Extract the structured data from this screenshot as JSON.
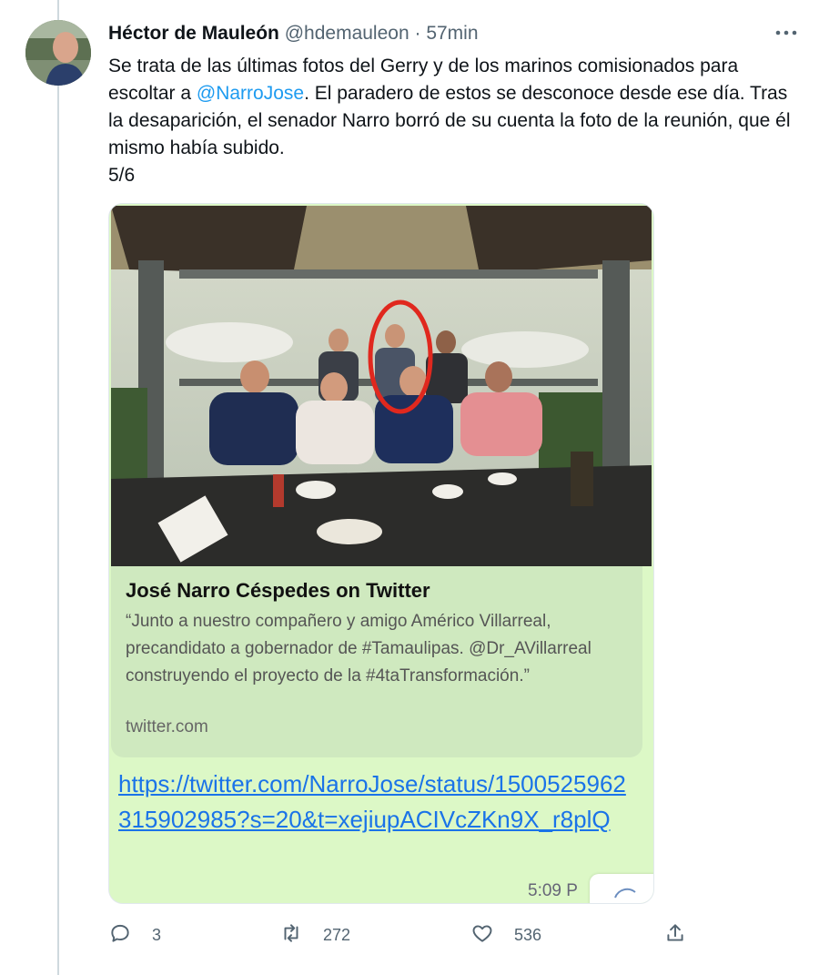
{
  "tweet": {
    "display_name": "Héctor de Mauleón",
    "handle": "@hdemauleon",
    "separator": "·",
    "time": "57min",
    "text_before": "Se trata de las últimas fotos del Gerry y de los marinos comisionados para escoltar a ",
    "mention": "@NarroJose",
    "text_after": ". El paradero de estos se desconoce desde ese día. Tras la desaparición, el senador Narro borró de su cuenta la foto de la reunión, que él mismo había subido.",
    "thread_count": "5/6"
  },
  "card": {
    "preview_title": "José Narro Céspedes on Twitter",
    "preview_description": "“Junto a nuestro compañero y amigo Américo Villarreal, precandidato a gobernador de #Tamaulipas. @Dr_AVillarreal construyendo el proyecto de la #4taTransformación.”",
    "preview_domain": "twitter.com",
    "url_text": "https://twitter.com/NarroJose/status/1500525962315902985?s=20&t=xejiupACIVcZKn9X_r8plQ",
    "message_time": "5:09 P"
  },
  "actions": {
    "replies": "3",
    "retweets": "272",
    "likes": "536"
  },
  "icons": {
    "more": "more-dots-icon",
    "reply": "reply-icon",
    "retweet": "retweet-icon",
    "like": "heart-icon",
    "share": "share-icon"
  },
  "colors": {
    "link": "#1d9bf0",
    "card_background": "#dcf8c6",
    "highlight_circle": "#e0281e"
  }
}
